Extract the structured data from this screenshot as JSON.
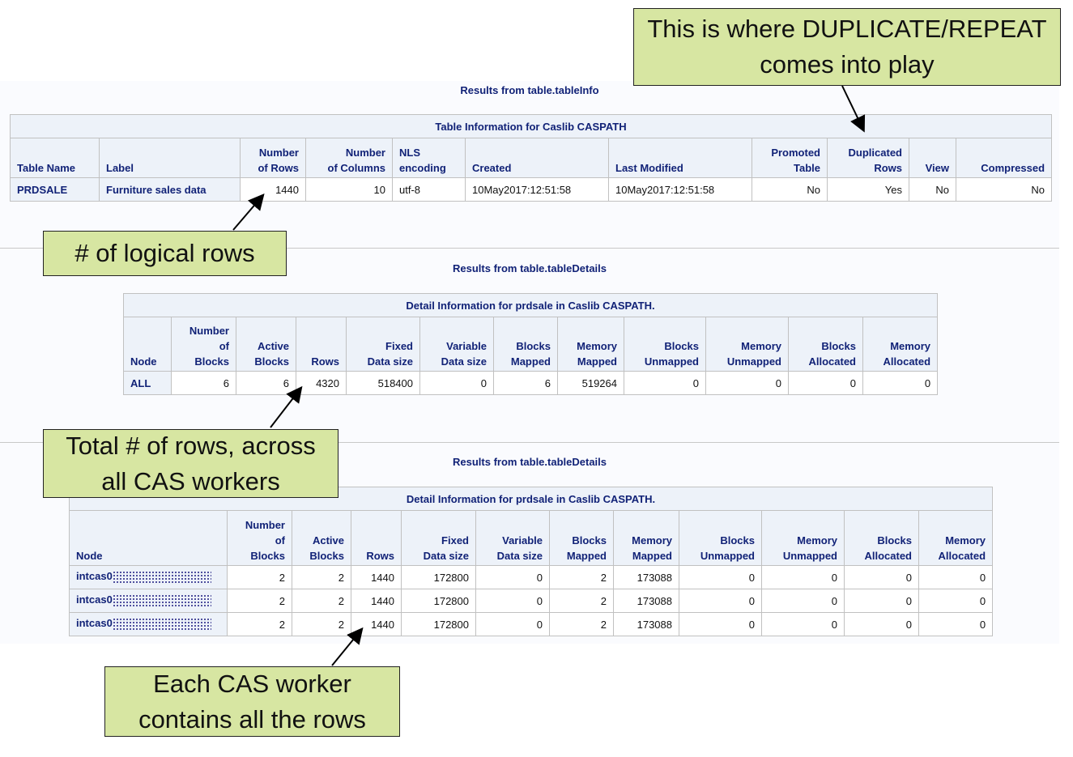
{
  "sections": [
    {
      "title": "Results from table.tableInfo",
      "caption": "Table Information for Caslib CASPATH",
      "headers": [
        "Table Name",
        "Label",
        "Number\nof Rows",
        "Number\nof Columns",
        "NLS\nencoding",
        "Created",
        "Last Modified",
        "Promoted\nTable",
        "Duplicated\nRows",
        "View",
        "Compressed"
      ],
      "rows": [
        [
          "PRDSALE",
          "Furniture sales data",
          "1440",
          "10",
          "utf-8",
          "10May2017:12:51:58",
          "10May2017:12:51:58",
          "No",
          "Yes",
          "No",
          "No"
        ]
      ]
    },
    {
      "title": "Results from table.tableDetails",
      "caption": "Detail Information for prdsale in Caslib CASPATH.",
      "headers": [
        "Node",
        "Number\nof\nBlocks",
        "Active\nBlocks",
        "Rows",
        "Fixed\nData size",
        "Variable\nData size",
        "Blocks\nMapped",
        "Memory\nMapped",
        "Blocks\nUnmapped",
        "Memory\nUnmapped",
        "Blocks\nAllocated",
        "Memory\nAllocated"
      ],
      "rows": [
        [
          "ALL",
          "6",
          "6",
          "4320",
          "518400",
          "0",
          "6",
          "519264",
          "0",
          "0",
          "0",
          "0"
        ]
      ]
    },
    {
      "title": "Results from table.tableDetails",
      "caption": "Detail Information for prdsale in Caslib CASPATH.",
      "headers": [
        "Node",
        "Number\nof\nBlocks",
        "Active\nBlocks",
        "Rows",
        "Fixed\nData size",
        "Variable\nData size",
        "Blocks\nMapped",
        "Memory\nMapped",
        "Blocks\nUnmapped",
        "Memory\nUnmapped",
        "Blocks\nAllocated",
        "Memory\nAllocated"
      ],
      "rows": [
        [
          "intcas0",
          "2",
          "2",
          "1440",
          "172800",
          "0",
          "2",
          "173088",
          "0",
          "0",
          "0",
          "0"
        ],
        [
          "intcas0",
          "2",
          "2",
          "1440",
          "172800",
          "0",
          "2",
          "173088",
          "0",
          "0",
          "0",
          "0"
        ],
        [
          "intcas0",
          "2",
          "2",
          "1440",
          "172800",
          "0",
          "2",
          "173088",
          "0",
          "0",
          "0",
          "0"
        ]
      ]
    }
  ],
  "callouts": {
    "duplicate": "This is where DUPLICATE/REPEAT comes into play",
    "logical": "# of logical rows",
    "total": "Total # of rows, across all CAS workers",
    "each": "Each CAS worker contains all the rows"
  }
}
